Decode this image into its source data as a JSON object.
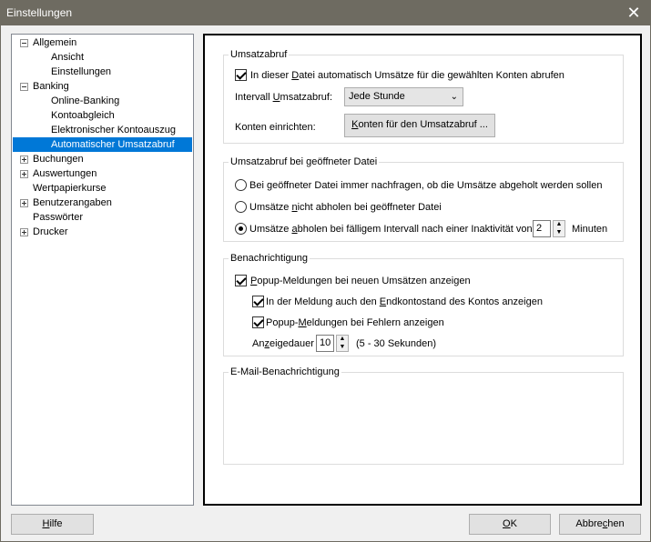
{
  "window": {
    "title": "Einstellungen"
  },
  "tree": {
    "items": [
      {
        "label": "Allgemein"
      },
      {
        "label": "Ansicht"
      },
      {
        "label": "Einstellungen"
      },
      {
        "label": "Banking"
      },
      {
        "label": "Online-Banking"
      },
      {
        "label": "Kontoabgleich"
      },
      {
        "label": "Elektronischer Kontoauszug"
      },
      {
        "label": "Automatischer Umsatzabruf"
      },
      {
        "label": "Buchungen"
      },
      {
        "label": "Auswertungen"
      },
      {
        "label": "Wertpapierkurse"
      },
      {
        "label": "Benutzerangaben"
      },
      {
        "label": "Passwörter"
      },
      {
        "label": "Drucker"
      }
    ]
  },
  "umsatzabruf": {
    "title": "Umsatzabruf",
    "auto_checkbox": {
      "pre": "In dieser ",
      "accel": "D",
      "post": "atei automatisch Umsätze für die gewählten Konten abrufen",
      "checked": true
    },
    "interval_label": {
      "pre": "Intervall ",
      "accel": "U",
      "post": "msatzabruf:"
    },
    "interval_value": "Jede Stunde",
    "konten_label": "Konten einrichten:",
    "konten_button": {
      "accel": "K",
      "post": "onten für den Umsatzabruf ..."
    }
  },
  "geoeffnet": {
    "title": "Umsatzabruf bei geöffneter Datei",
    "opt1": {
      "pre": "Bei ",
      "accel": "g",
      "post": "eöffneter Datei immer nachfragen, ob die Umsätze abgeholt werden sollen",
      "checked": false
    },
    "opt2": {
      "pre": "Umsätze ",
      "accel": "n",
      "post": "icht abholen bei geöffneter Datei",
      "checked": false
    },
    "opt3": {
      "pre": "Umsätze ",
      "accel": "a",
      "post": "bholen bei fälligem Intervall nach einer Inaktivität von",
      "checked": true
    },
    "minutes_value": "2",
    "minutes_unit": "Minuten"
  },
  "benachrichtigung": {
    "title": "Benachrichtigung",
    "popup": {
      "accel": "P",
      "post": "opup-Meldungen bei neuen Umsätzen anzeigen",
      "checked": true
    },
    "endkontostand": {
      "pre": "In der Meldung auch den ",
      "accel": "E",
      "post": "ndkontostand des Kontos anzeigen",
      "checked": true
    },
    "fehler": {
      "pre": "Popup-",
      "accel": "M",
      "post": "eldungen bei Fehlern anzeigen",
      "checked": true
    },
    "dauer_label": {
      "pre": "An",
      "accel": "z",
      "post": "eigedauer"
    },
    "dauer_value": "10",
    "dauer_range": "(5 - 30 Sekunden)"
  },
  "email": {
    "title": "E-Mail-Benachrichtigung"
  },
  "buttons": {
    "help": {
      "pre": "",
      "accel": "H",
      "post": "ilfe"
    },
    "ok": {
      "pre": "",
      "accel": "O",
      "post": "K"
    },
    "cancel": {
      "pre": "Abbre",
      "accel": "c",
      "post": "hen"
    }
  }
}
